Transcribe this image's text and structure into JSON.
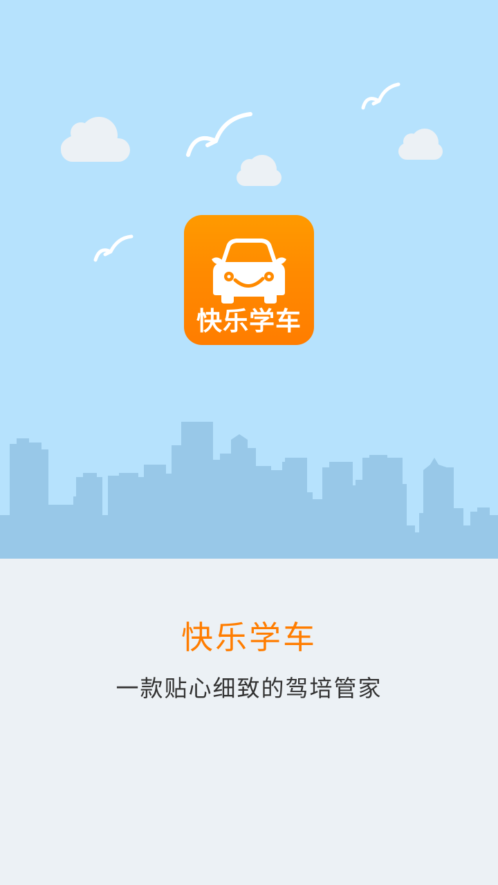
{
  "splash": {
    "icon_label": "快乐学车",
    "title": "快乐学车",
    "slogan": "一款贴心细致的驾培管家"
  },
  "icons": {
    "app_icon": "car-icon",
    "clouds": "cloud-icon",
    "birds": "bird-icon",
    "skyline": "city-skyline"
  },
  "colors": {
    "sky": "#b6e2fd",
    "skyline": "#98c8e8",
    "ground": "#ecf1f5",
    "brand_orange": "#ff8a00",
    "title_orange": "#ff7d00",
    "slogan_text": "#333333",
    "cloud": "#ecf1f5"
  }
}
